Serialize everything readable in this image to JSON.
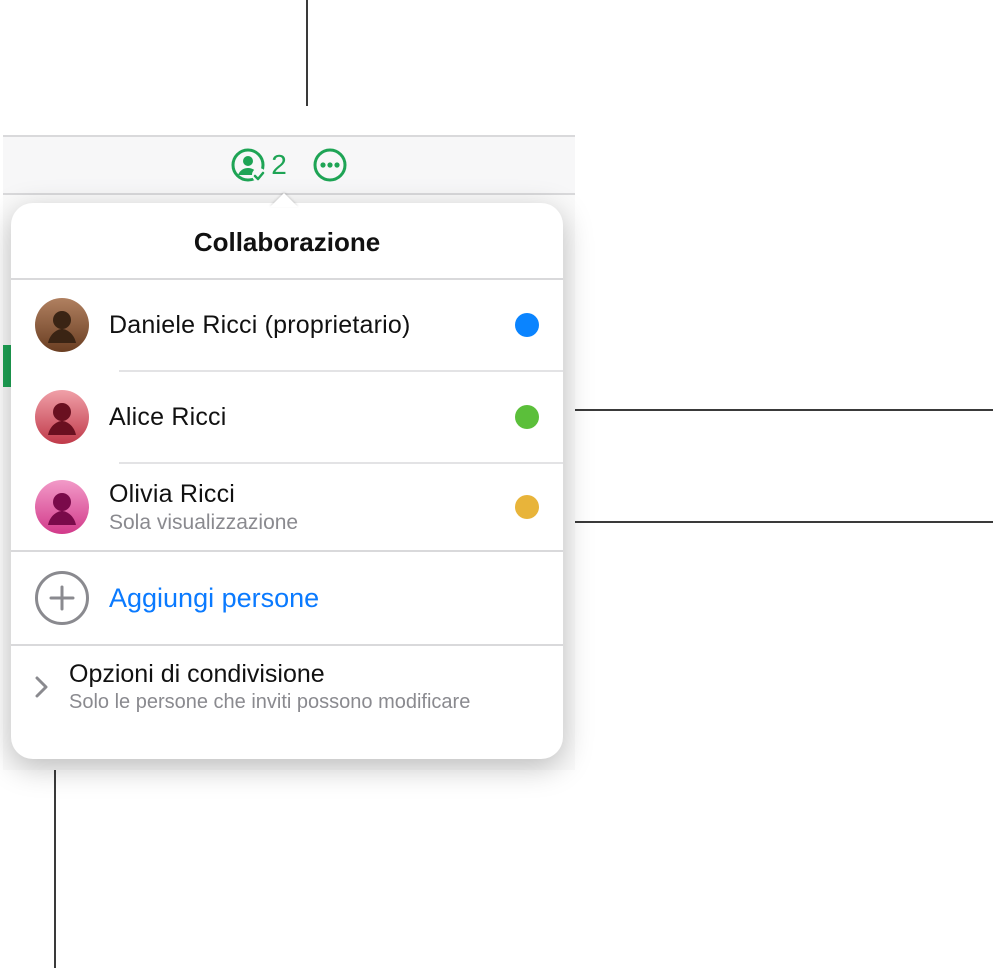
{
  "toolbar": {
    "collab_count": "2"
  },
  "panel": {
    "title": "Collaborazione",
    "people": [
      {
        "name": "Daniele Ricci (proprietario)",
        "sub": "",
        "dot": "#0a84ff",
        "avatar_bg": "#7a4a2a"
      },
      {
        "name": "Alice Ricci",
        "sub": "",
        "dot": "#5bbf3a",
        "avatar_bg": "#d24a5a"
      },
      {
        "name": "Olivia Ricci",
        "sub": "Sola visualizzazione",
        "dot": "#e8b43a",
        "avatar_bg": "#e85aa0"
      }
    ],
    "add_label": "Aggiungi persone",
    "options": {
      "title": "Opzioni di condivisione",
      "sub": "Solo le persone che inviti possono modificare"
    }
  },
  "colors": {
    "accent_green": "#1ea455",
    "link_blue": "#0a7aff"
  }
}
